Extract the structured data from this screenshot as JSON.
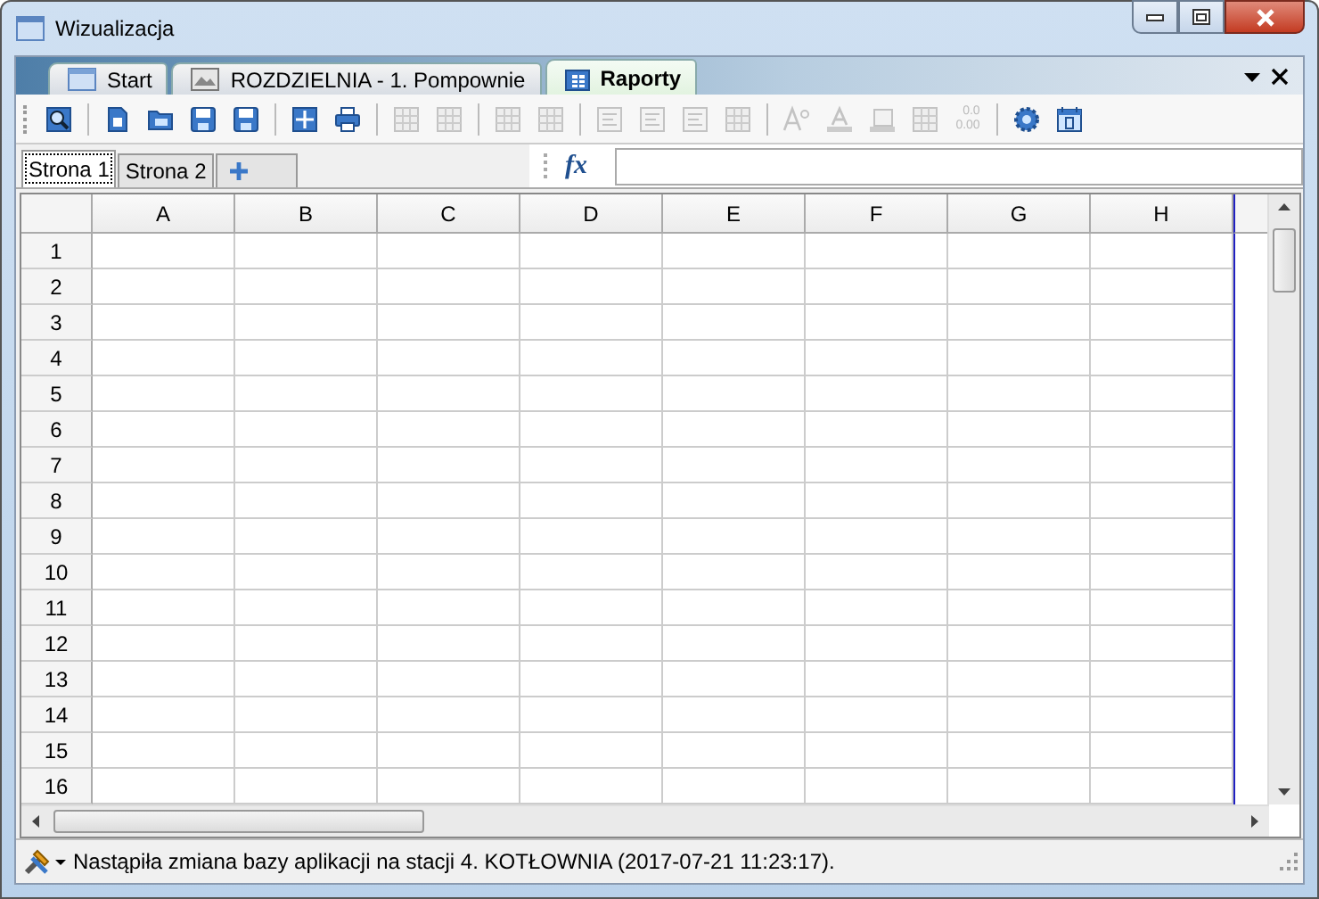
{
  "window": {
    "title": "Wizualizacja"
  },
  "doc_tabs": [
    {
      "label": "Start",
      "kind": "window",
      "selected": false
    },
    {
      "label": "ROZDZIELNIA - 1. Pompownie",
      "kind": "picture",
      "selected": false
    },
    {
      "label": "Raporty",
      "kind": "report",
      "selected": true
    }
  ],
  "toolbar": {
    "groups": [
      [
        {
          "kind": "preview",
          "disabled": false
        }
      ],
      [
        {
          "kind": "new",
          "disabled": false
        },
        {
          "kind": "open",
          "disabled": false
        },
        {
          "kind": "save",
          "disabled": false
        },
        {
          "kind": "save-as",
          "disabled": false
        }
      ],
      [
        {
          "kind": "insert",
          "disabled": false
        },
        {
          "kind": "print",
          "disabled": false
        }
      ],
      [
        {
          "kind": "grid",
          "disabled": true
        },
        {
          "kind": "grid",
          "disabled": true
        }
      ],
      [
        {
          "kind": "grid",
          "disabled": true
        },
        {
          "kind": "grid",
          "disabled": true
        }
      ],
      [
        {
          "kind": "align-left",
          "disabled": true
        },
        {
          "kind": "align-center",
          "disabled": true
        },
        {
          "kind": "align-right",
          "disabled": true
        },
        {
          "kind": "merge",
          "disabled": true
        }
      ],
      [
        {
          "kind": "font-size",
          "disabled": true
        },
        {
          "kind": "font-color",
          "disabled": true
        },
        {
          "kind": "border",
          "disabled": true
        },
        {
          "kind": "cells",
          "disabled": true
        },
        {
          "kind": "decimal",
          "disabled": true,
          "lines": [
            "0.0",
            "0.00"
          ]
        }
      ],
      [
        {
          "kind": "settings",
          "disabled": false
        },
        {
          "kind": "calendar",
          "disabled": false
        }
      ]
    ]
  },
  "sheet_tabs": [
    {
      "label": "Strona 1",
      "selected": true
    },
    {
      "label": "Strona 2",
      "selected": false
    }
  ],
  "formula_bar": {
    "label": "fx"
  },
  "table": {
    "columns": [
      "A",
      "B",
      "C",
      "D",
      "E",
      "F",
      "G",
      "H"
    ],
    "rows": [
      "1",
      "2",
      "3",
      "4",
      "5",
      "6",
      "7",
      "8",
      "9",
      "10",
      "11",
      "12",
      "13",
      "14",
      "15",
      "16"
    ]
  },
  "status_bar": {
    "message": "Nastąpiła zmiana bazy aplikacji na stacji 4. KOTŁOWNIA (2017-07-21 11:23:17)."
  }
}
